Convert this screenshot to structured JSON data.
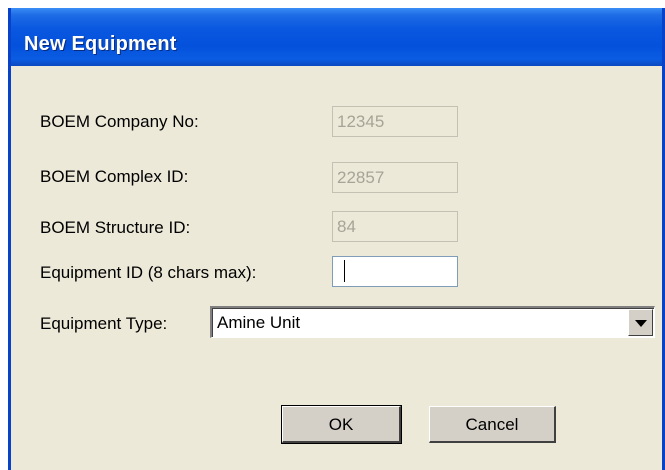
{
  "window": {
    "title": "New Equipment"
  },
  "form": {
    "company_no": {
      "label": "BOEM Company No:",
      "value": "12345"
    },
    "complex_id": {
      "label": "BOEM Complex ID:",
      "value": "22857"
    },
    "structure_id": {
      "label": "BOEM Structure ID:",
      "value": "84"
    },
    "equipment_id": {
      "label": "Equipment ID (8 chars max):",
      "value": ""
    },
    "equipment_type": {
      "label": "Equipment Type:",
      "selected": "Amine Unit"
    }
  },
  "buttons": {
    "ok": "OK",
    "cancel": "Cancel"
  }
}
